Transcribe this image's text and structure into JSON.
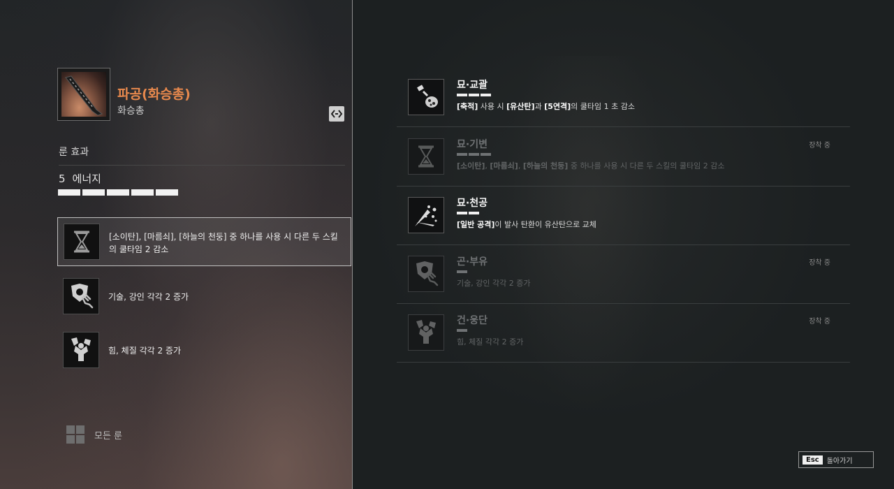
{
  "weapon": {
    "name": "파공(화승총)",
    "type": "화승총",
    "icon": "musket-icon",
    "name_color": "#e8894d"
  },
  "rune_effect": {
    "label": "룬 효과",
    "energy_value": "5",
    "energy_label": "에너지",
    "energy_bars": 5
  },
  "effects": [
    {
      "icon": "hourglass-icon",
      "text": "[소이탄], [마름쇠], [하늘의 천둥] 중 하나를 사용 시 다른 두 스킬의 쿨타임 2 감소",
      "selected": true
    },
    {
      "icon": "shield-hand-icon",
      "text": "기술, 강인 각각 2 증가",
      "selected": false
    },
    {
      "icon": "strength-icon",
      "text": "힘, 체질 각각 2 증가",
      "selected": false
    }
  ],
  "all_runes_label": "모든 룬",
  "runes": [
    {
      "icon": "bomb-icon",
      "name": "묘·교괄",
      "bars": 3,
      "desc_parts": [
        "[축적]",
        " 사용 시 ",
        "[유산탄]",
        "과 ",
        "[5연격]",
        "의 쿨타임 1 초 감소"
      ],
      "equipped": "",
      "dim": false
    },
    {
      "icon": "hourglass-icon",
      "name": "묘·기변",
      "bars": 3,
      "desc_parts": [
        "[소이탄]",
        ", ",
        "[마름쇠]",
        ", ",
        "[하늘의 천둥]",
        " 중 하나를 사용 시 다른 두 스킬의 쿨타임 2 감소"
      ],
      "equipped": "장착 중",
      "dim": true
    },
    {
      "icon": "scatter-shot-icon",
      "name": "묘·천공",
      "bars": 2,
      "desc_parts": [
        "[일반 공격]",
        "이 발사 탄환이 유산탄으로 교체"
      ],
      "equipped": "",
      "dim": false
    },
    {
      "icon": "shield-hand-icon",
      "name": "곤·부유",
      "bars": 1,
      "desc_parts": [
        "",
        "기술, 강인 각각 2 증가"
      ],
      "equipped": "장착 중",
      "dim": true
    },
    {
      "icon": "strength-icon",
      "name": "건·웅단",
      "bars": 1,
      "desc_parts": [
        "",
        "힘, 체질 각각 2 증가"
      ],
      "equipped": "장착 중",
      "dim": true
    }
  ],
  "esc": {
    "key": "Esc",
    "label": "돌아가기"
  }
}
